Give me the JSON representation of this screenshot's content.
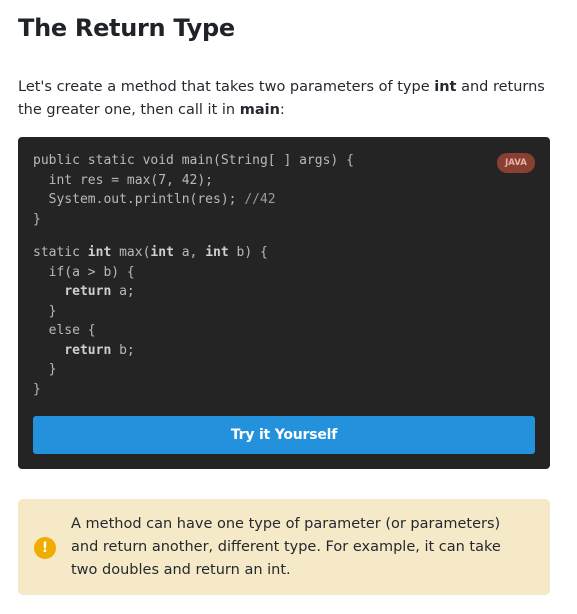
{
  "page": {
    "title": "The Return Type"
  },
  "intro": {
    "part1": "Let's create a method that takes two parameters of type ",
    "bold1": "int",
    "part2": " and returns the greater one, then call it in ",
    "bold2": "main",
    "part3": ":"
  },
  "code_block": {
    "language": "JAVA",
    "lines": {
      "l1": "public static void main(String[ ] args) {",
      "l2": "  int res = max(7, 42);",
      "l3_code": "  System.out.println(res); ",
      "l3_comment": "//42",
      "l4": "}",
      "l5_a": "static ",
      "l5_kw1": "int",
      "l5_b": " max(",
      "l5_kw2": "int",
      "l5_c": " a, ",
      "l5_kw3": "int",
      "l5_d": " b) {",
      "l6": "  if(a > b) {",
      "l7_indent": "    ",
      "l7_kw": "return",
      "l7_rest": " a;",
      "l8": "  }",
      "l9": "  else {",
      "l10_indent": "    ",
      "l10_kw": "return",
      "l10_rest": " b;",
      "l11": "  }",
      "l12": "}"
    },
    "try_button_label": "Try it Yourself"
  },
  "note": {
    "icon": "exclamation-icon",
    "text": "A method can have one type of parameter (or parameters) and return another, different type. For example, it can take two doubles and return an int."
  },
  "colors": {
    "code_background": "#242424",
    "button_blue": "#2491dd",
    "badge_background": "#8a3f33",
    "note_background": "#f6e9c8",
    "note_icon": "#f0ad00"
  }
}
